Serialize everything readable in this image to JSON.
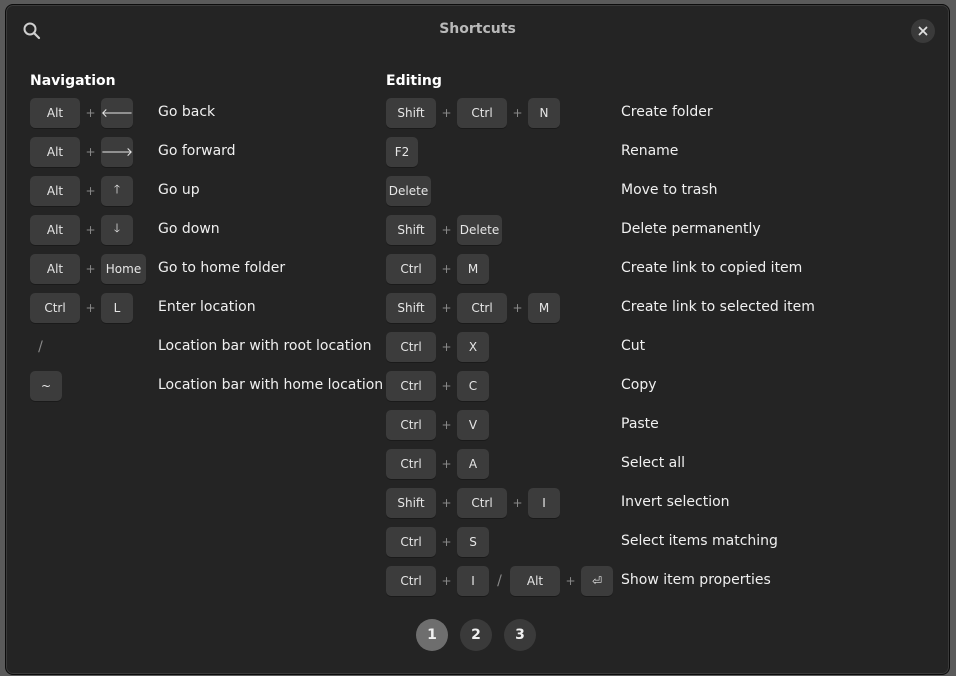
{
  "window": {
    "title": "Shortcuts"
  },
  "icons": {
    "search": "search-icon",
    "close": "close-icon"
  },
  "navigation": {
    "title": "Navigation",
    "rows": [
      {
        "keys": [
          "Alt",
          "+",
          "🡐"
        ],
        "desc": "Go back"
      },
      {
        "keys": [
          "Alt",
          "+",
          "🡒"
        ],
        "desc": "Go forward"
      },
      {
        "keys": [
          "Alt",
          "+",
          "🡑"
        ],
        "desc": "Go up"
      },
      {
        "keys": [
          "Alt",
          "+",
          "🡓"
        ],
        "desc": "Go down"
      },
      {
        "keys": [
          "Alt",
          "+",
          "Home"
        ],
        "desc": "Go to home folder"
      },
      {
        "keys": [
          "Ctrl",
          "+",
          "L"
        ],
        "desc": "Enter location"
      },
      {
        "keys": [
          "/"
        ],
        "desc": "Location bar with root location"
      },
      {
        "keys": [
          "~"
        ],
        "desc": "Location bar with home location"
      }
    ]
  },
  "editing": {
    "title": "Editing",
    "rows": [
      {
        "keys": [
          "Shift",
          "+",
          "Ctrl",
          "+",
          "N"
        ],
        "desc": "Create folder"
      },
      {
        "keys": [
          "F2"
        ],
        "desc": "Rename"
      },
      {
        "keys": [
          "Delete"
        ],
        "desc": "Move to trash"
      },
      {
        "keys": [
          "Shift",
          "+",
          "Delete"
        ],
        "desc": "Delete permanently"
      },
      {
        "keys": [
          "Ctrl",
          "+",
          "M"
        ],
        "desc": "Create link to copied item"
      },
      {
        "keys": [
          "Shift",
          "+",
          "Ctrl",
          "+",
          "M"
        ],
        "desc": "Create link to selected item"
      },
      {
        "keys": [
          "Ctrl",
          "+",
          "X"
        ],
        "desc": "Cut"
      },
      {
        "keys": [
          "Ctrl",
          "+",
          "C"
        ],
        "desc": "Copy"
      },
      {
        "keys": [
          "Ctrl",
          "+",
          "V"
        ],
        "desc": "Paste"
      },
      {
        "keys": [
          "Ctrl",
          "+",
          "A"
        ],
        "desc": "Select all"
      },
      {
        "keys": [
          "Shift",
          "+",
          "Ctrl",
          "+",
          "I"
        ],
        "desc": "Invert selection"
      },
      {
        "keys": [
          "Ctrl",
          "+",
          "S"
        ],
        "desc": "Select items matching"
      },
      {
        "keys": [
          "Ctrl",
          "+",
          "I",
          "/",
          "Alt",
          "+",
          "⏎"
        ],
        "desc": "Show item properties"
      }
    ]
  },
  "pager": {
    "pages": [
      "1",
      "2",
      "3"
    ],
    "active": "1"
  }
}
